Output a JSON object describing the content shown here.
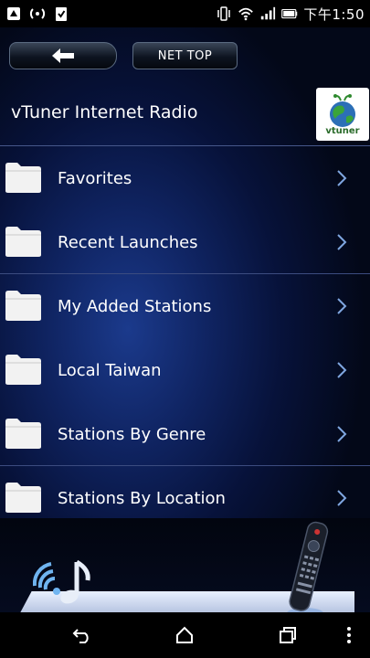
{
  "status_bar": {
    "time": "下午1:50",
    "left_icons": [
      "signal-icon",
      "wifi-hotspot-icon",
      "clipboard-check-icon"
    ],
    "right_icons": [
      "vibrate-icon",
      "wifi-icon",
      "cell-signal-icon",
      "battery-icon"
    ]
  },
  "toolbar": {
    "back_label": "",
    "net_top_label": "NET TOP"
  },
  "header": {
    "title": "vTuner Internet Radio",
    "logo_text": "vtuner"
  },
  "menu": {
    "items": [
      {
        "label": "Favorites"
      },
      {
        "label": "Recent Launches"
      },
      {
        "label": "My Added Stations"
      },
      {
        "label": "Local Taiwan"
      },
      {
        "label": "Stations By Genre"
      },
      {
        "label": "Stations By Location"
      }
    ]
  },
  "nav_bar": {
    "buttons": [
      "back-nav-icon",
      "home-nav-icon",
      "recents-nav-icon",
      "overflow-menu-icon"
    ]
  },
  "colors": {
    "background_dark": "#030818",
    "background_glow": "#1b3a8c",
    "divider": "#46578a",
    "chevron": "#7fa6e0"
  }
}
